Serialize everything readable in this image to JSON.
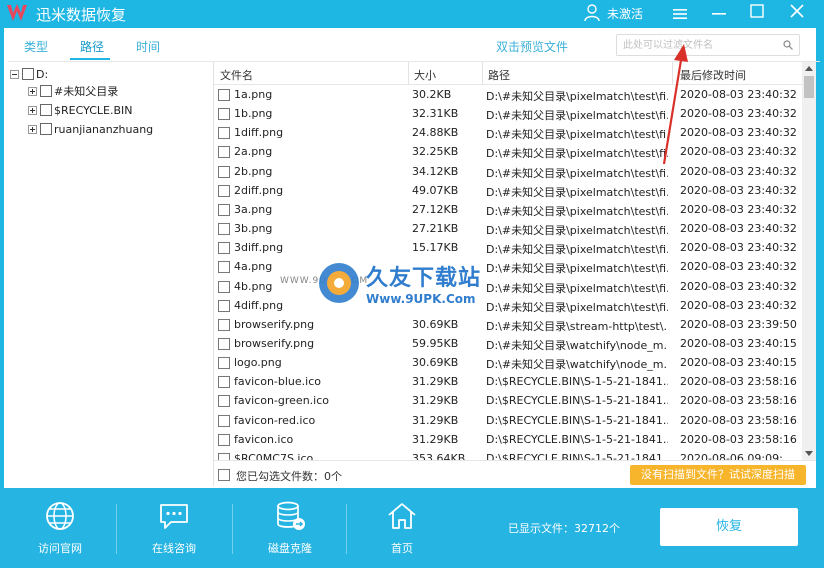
{
  "app": {
    "title": "迅米数据恢复",
    "user_label": "未激活"
  },
  "tabs": [
    {
      "label": "类型"
    },
    {
      "label": "路径"
    },
    {
      "label": "时间"
    }
  ],
  "toolbar": {
    "preview_label": "双击预览文件",
    "search_placeholder": "此处可以过滤文件名"
  },
  "tree": {
    "root": "D:",
    "children": [
      {
        "label": "#未知父目录"
      },
      {
        "label": "$RECYCLE.BIN"
      },
      {
        "label": "ruanjiananzhuang"
      }
    ]
  },
  "table": {
    "headers": [
      "文件名",
      "大小",
      "路径",
      "最后修改时间"
    ],
    "rows": [
      {
        "name": "1a.png",
        "size": "30.2KB",
        "path": "D:\\#未知父目录\\pixelmatch\\test\\fi...",
        "time": "2020-08-03 23:40:32"
      },
      {
        "name": "1b.png",
        "size": "32.31KB",
        "path": "D:\\#未知父目录\\pixelmatch\\test\\fi...",
        "time": "2020-08-03 23:40:32"
      },
      {
        "name": "1diff.png",
        "size": "24.88KB",
        "path": "D:\\#未知父目录\\pixelmatch\\test\\fi...",
        "time": "2020-08-03 23:40:32"
      },
      {
        "name": "2a.png",
        "size": "32.25KB",
        "path": "D:\\#未知父目录\\pixelmatch\\test\\fi...",
        "time": "2020-08-03 23:40:32"
      },
      {
        "name": "2b.png",
        "size": "34.12KB",
        "path": "D:\\#未知父目录\\pixelmatch\\test\\fi...",
        "time": "2020-08-03 23:40:32"
      },
      {
        "name": "2diff.png",
        "size": "49.07KB",
        "path": "D:\\#未知父目录\\pixelmatch\\test\\fi...",
        "time": "2020-08-03 23:40:32"
      },
      {
        "name": "3a.png",
        "size": "27.12KB",
        "path": "D:\\#未知父目录\\pixelmatch\\test\\fi...",
        "time": "2020-08-03 23:40:32"
      },
      {
        "name": "3b.png",
        "size": "27.21KB",
        "path": "D:\\#未知父目录\\pixelmatch\\test\\fi...",
        "time": "2020-08-03 23:40:32"
      },
      {
        "name": "3diff.png",
        "size": "15.17KB",
        "path": "D:\\#未知父目录\\pixelmatch\\test\\fi...",
        "time": "2020-08-03 23:40:32"
      },
      {
        "name": "4a.png",
        "size": "",
        "path": "D:\\#未知父目录\\pixelmatch\\test\\fi...",
        "time": "2020-08-03 23:40:32"
      },
      {
        "name": "4b.png",
        "size": "",
        "path": "D:\\#未知父目录\\pixelmatch\\test\\fi...",
        "time": "2020-08-03 23:40:32"
      },
      {
        "name": "4diff.png",
        "size": "",
        "path": "D:\\#未知父目录\\pixelmatch\\test\\fi...",
        "time": "2020-08-03 23:40:32"
      },
      {
        "name": "browserify.png",
        "size": "30.69KB",
        "path": "D:\\#未知父目录\\stream-http\\test\\...",
        "time": "2020-08-03 23:39:50"
      },
      {
        "name": "browserify.png",
        "size": "59.95KB",
        "path": "D:\\#未知父目录\\watchify\\node_m...",
        "time": "2020-08-03 23:40:15"
      },
      {
        "name": "logo.png",
        "size": "30.69KB",
        "path": "D:\\#未知父目录\\watchify\\node_m...",
        "time": "2020-08-03 23:40:15"
      },
      {
        "name": "favicon-blue.ico",
        "size": "31.29KB",
        "path": "D:\\$RECYCLE.BIN\\S-1-5-21-1841...",
        "time": "2020-08-03 23:58:16"
      },
      {
        "name": "favicon-green.ico",
        "size": "31.29KB",
        "path": "D:\\$RECYCLE.BIN\\S-1-5-21-1841...",
        "time": "2020-08-03 23:58:16"
      },
      {
        "name": "favicon-red.ico",
        "size": "31.29KB",
        "path": "D:\\$RECYCLE.BIN\\S-1-5-21-1841...",
        "time": "2020-08-03 23:58:16"
      },
      {
        "name": "favicon.ico",
        "size": "31.29KB",
        "path": "D:\\$RECYCLE.BIN\\S-1-5-21-1841...",
        "time": "2020-08-03 23:58:16"
      },
      {
        "name": "$RC0MC7S.ico",
        "size": "353.64KB",
        "path": "D:\\$RECYCLE.BIN\\S-1-5-21-1841...",
        "time": "2020-08-06 09:09:..."
      }
    ]
  },
  "selection": {
    "label": "您已勾选文件数：0个",
    "deep_scan_label": "没有扫描到文件？试试深度扫描"
  },
  "bottom": {
    "items": [
      {
        "label": "访问官网",
        "icon": "globe-icon"
      },
      {
        "label": "在线咨询",
        "icon": "chat-icon"
      },
      {
        "label": "磁盘克隆",
        "icon": "disk-clone-icon"
      },
      {
        "label": "首页",
        "icon": "home-icon"
      }
    ],
    "shown_files": "已显示文件：32712个",
    "recover_label": "恢复"
  },
  "watermark": {
    "title": "久友下载站",
    "url": "Www.9UPK.Com",
    "prefix": "WWW.9UPK.COM"
  },
  "colors": {
    "primary": "#1eb6e3",
    "bottom_bar": "#26b4e2",
    "deep_scan": "#f7b52c",
    "annotation": "#d9302a"
  }
}
